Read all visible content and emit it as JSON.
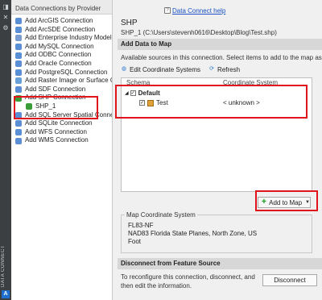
{
  "strip": {
    "vertical_label": "DATA CONNECT",
    "icons": [
      "pin-icon",
      "close-icon",
      "settings-icon"
    ],
    "logo_glyph": "A"
  },
  "left": {
    "header": "Data Connections by Provider",
    "items": [
      {
        "label": "Add ArcGIS Connection",
        "icon": "arcgis-icon",
        "color": "#5a8fd6"
      },
      {
        "label": "Add ArcSDE Connection",
        "icon": "arcsde-icon",
        "color": "#5a8fd6"
      },
      {
        "label": "Add Enterprise Industry Model C",
        "icon": "enterprise-icon",
        "color": "#7a9ccf"
      },
      {
        "label": "Add MySQL Connection",
        "icon": "mysql-icon",
        "color": "#5a8fd6"
      },
      {
        "label": "Add ODBC Connection",
        "icon": "odbc-icon",
        "color": "#5a8fd6"
      },
      {
        "label": "Add Oracle Connection",
        "icon": "oracle-icon",
        "color": "#5a8fd6"
      },
      {
        "label": "Add PostgreSQL Connection",
        "icon": "postgresql-icon",
        "color": "#5a8fd6"
      },
      {
        "label": "Add Raster Image or Surface Co",
        "icon": "raster-icon",
        "color": "#6aa0d8"
      },
      {
        "label": "Add SDF Connection",
        "icon": "sdf-icon",
        "color": "#5a8fd6"
      },
      {
        "label": "Add SHP Connection",
        "icon": "shp-icon",
        "color": "#3a9d3a"
      },
      {
        "label": "SHP_1",
        "icon": "shp-connection-icon",
        "color": "#3a9d3a",
        "child": true
      },
      {
        "label": "Add SQL Server Spatial Connecti",
        "icon": "sqlserver-icon",
        "color": "#5a8fd6"
      },
      {
        "label": "Add SQLite Connection",
        "icon": "sqlite-icon",
        "color": "#5a8fd6"
      },
      {
        "label": "Add WFS Connection",
        "icon": "wfs-icon",
        "color": "#5a8fd6"
      },
      {
        "label": "Add WMS Connection",
        "icon": "wms-icon",
        "color": "#5a8fd6"
      }
    ]
  },
  "right": {
    "help_link": "Data Connect help",
    "connection_title": "SHP",
    "connection_path": "SHP_1 (C:\\Users\\stevenh0616\\Desktop\\Blog\\Test.shp)",
    "add_section_title": "Add Data to Map",
    "add_description": "Available sources in this connection.  Select items to add to the map as lay",
    "toolbar": {
      "edit_cs": "Edit Coordinate Systems",
      "refresh": "Refresh"
    },
    "schema": {
      "col_schema": "Schema",
      "col_cs": "Coordinate System",
      "default_label": "Default",
      "test_label": "Test",
      "test_cs": "< unknown >"
    },
    "add_to_map": "Add to Map",
    "map_cs": {
      "legend": "Map Coordinate System",
      "code": "FL83-NF",
      "description": "NAD83 Florida State Planes, North Zone, US Foot"
    },
    "disconnect_section_title": "Disconnect from Feature Source",
    "disconnect_text": "To reconfigure this connection, disconnect, and then edit the information.",
    "disconnect_button": "Disconnect"
  },
  "colors": {
    "highlight_red": "#e0141c",
    "link_blue": "#1a52c4"
  }
}
